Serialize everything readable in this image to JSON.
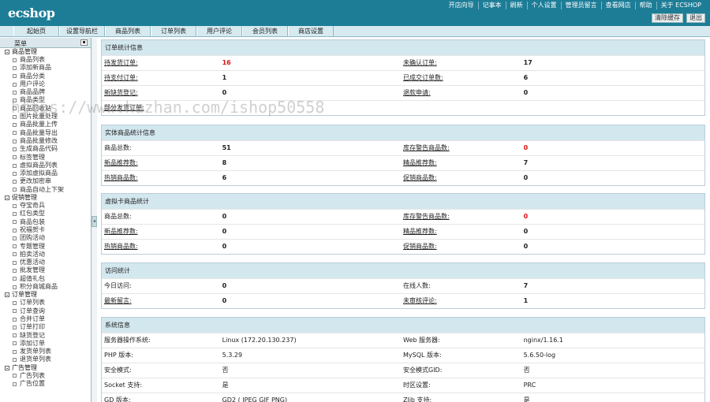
{
  "app": {
    "logo": "ecshop"
  },
  "top_links": [
    "开店向导",
    "记事本",
    "刷新",
    "个人设置",
    "管理员留言",
    "查看网店",
    "帮助",
    "关于 ECSHOP"
  ],
  "top_buttons": [
    "清除缓存",
    "退出"
  ],
  "nav_tabs": [
    "起始页",
    "设置导航栏",
    "商品列表",
    "订单列表",
    "用户评论",
    "会员列表",
    "商店设置"
  ],
  "sidebar": {
    "title": "菜单",
    "groups": [
      {
        "title": "商品管理",
        "items": [
          "商品列表",
          "添加新商品",
          "商品分类",
          "用户评论",
          "商品品牌",
          "商品类型",
          "商品回收站",
          "图片批量处理",
          "商品批量上传",
          "商品批量导出",
          "商品批量修改",
          "生成商品代码",
          "标签管理",
          "虚拟商品列表",
          "添加虚拟商品",
          "更改加密串",
          "商品自动上下架"
        ]
      },
      {
        "title": "促销管理",
        "items": [
          "夺宝奇兵",
          "红包类型",
          "商品包装",
          "祝福贺卡",
          "团购活动",
          "专题管理",
          "拍卖活动",
          "优惠活动",
          "批发管理",
          "超值礼包",
          "积分商城商品"
        ]
      },
      {
        "title": "订单管理",
        "items": [
          "订单列表",
          "订单查询",
          "合并订单",
          "订单打印",
          "缺货登记",
          "添加订单",
          "发货单列表",
          "退货单列表"
        ]
      },
      {
        "title": "广告管理",
        "items": [
          "广告列表",
          "广告位置"
        ]
      }
    ]
  },
  "panels": {
    "orders": {
      "title": "订单统计信息",
      "rows": [
        {
          "l1": "待发货订单:",
          "v1": "16",
          "l2": "未确认订单:",
          "v2": "17"
        },
        {
          "l1": "待支付订单:",
          "v1": "1",
          "l2": "已成交订单数:",
          "v2": "6"
        },
        {
          "l1": "新缺货登记:",
          "v1": "0",
          "l2": "退款申请:",
          "v2": "0"
        },
        {
          "l1": "部分发货订单:",
          "v1": "",
          "l2": "",
          "v2": ""
        }
      ]
    },
    "goods": {
      "title": "实体商品统计信息",
      "rows": [
        {
          "l1": "商品总数:",
          "v1": "51",
          "l2": "库存警告商品数:",
          "v2": "0"
        },
        {
          "l1": "新品推荐数:",
          "v1": "8",
          "l2": "精品推荐数:",
          "v2": "7"
        },
        {
          "l1": "热销商品数:",
          "v1": "6",
          "l2": "促销商品数:",
          "v2": "0"
        }
      ]
    },
    "virtual": {
      "title": "虚拟卡商品统计",
      "rows": [
        {
          "l1": "商品总数:",
          "v1": "0",
          "l2": "库存警告商品数:",
          "v2": "0"
        },
        {
          "l1": "新品推荐数:",
          "v1": "0",
          "l2": "精品推荐数:",
          "v2": "0"
        },
        {
          "l1": "热销商品数:",
          "v1": "0",
          "l2": "促销商品数:",
          "v2": "0"
        }
      ]
    },
    "visits": {
      "title": "访问统计",
      "rows": [
        {
          "l1": "今日访问:",
          "v1": "0",
          "l2": "在线人数:",
          "v2": "7"
        },
        {
          "l1": "最新留言:",
          "v1": "0",
          "l2": "未审核评论:",
          "v2": "1"
        }
      ]
    },
    "system": {
      "title": "系统信息",
      "rows": [
        {
          "l1": "服务器操作系统:",
          "v1": "Linux (172.20.130.237)",
          "l2": "Web 服务器:",
          "v2": "nginx/1.16.1"
        },
        {
          "l1": "PHP 版本:",
          "v1": "5.3.29",
          "l2": "MySQL 版本:",
          "v2": "5.6.50-log"
        },
        {
          "l1": "安全模式:",
          "v1": "否",
          "l2": "安全模式GID:",
          "v2": "否"
        },
        {
          "l1": "Socket 支持:",
          "v1": "是",
          "l2": "时区设置:",
          "v2": "PRC"
        },
        {
          "l1": "GD 版本:",
          "v1": "GD2 ( JPEG GIF PNG)",
          "l2": "Zlib 支持:",
          "v2": "是"
        }
      ]
    }
  },
  "watermark": "https://www.huzhan.com/ishop50558"
}
